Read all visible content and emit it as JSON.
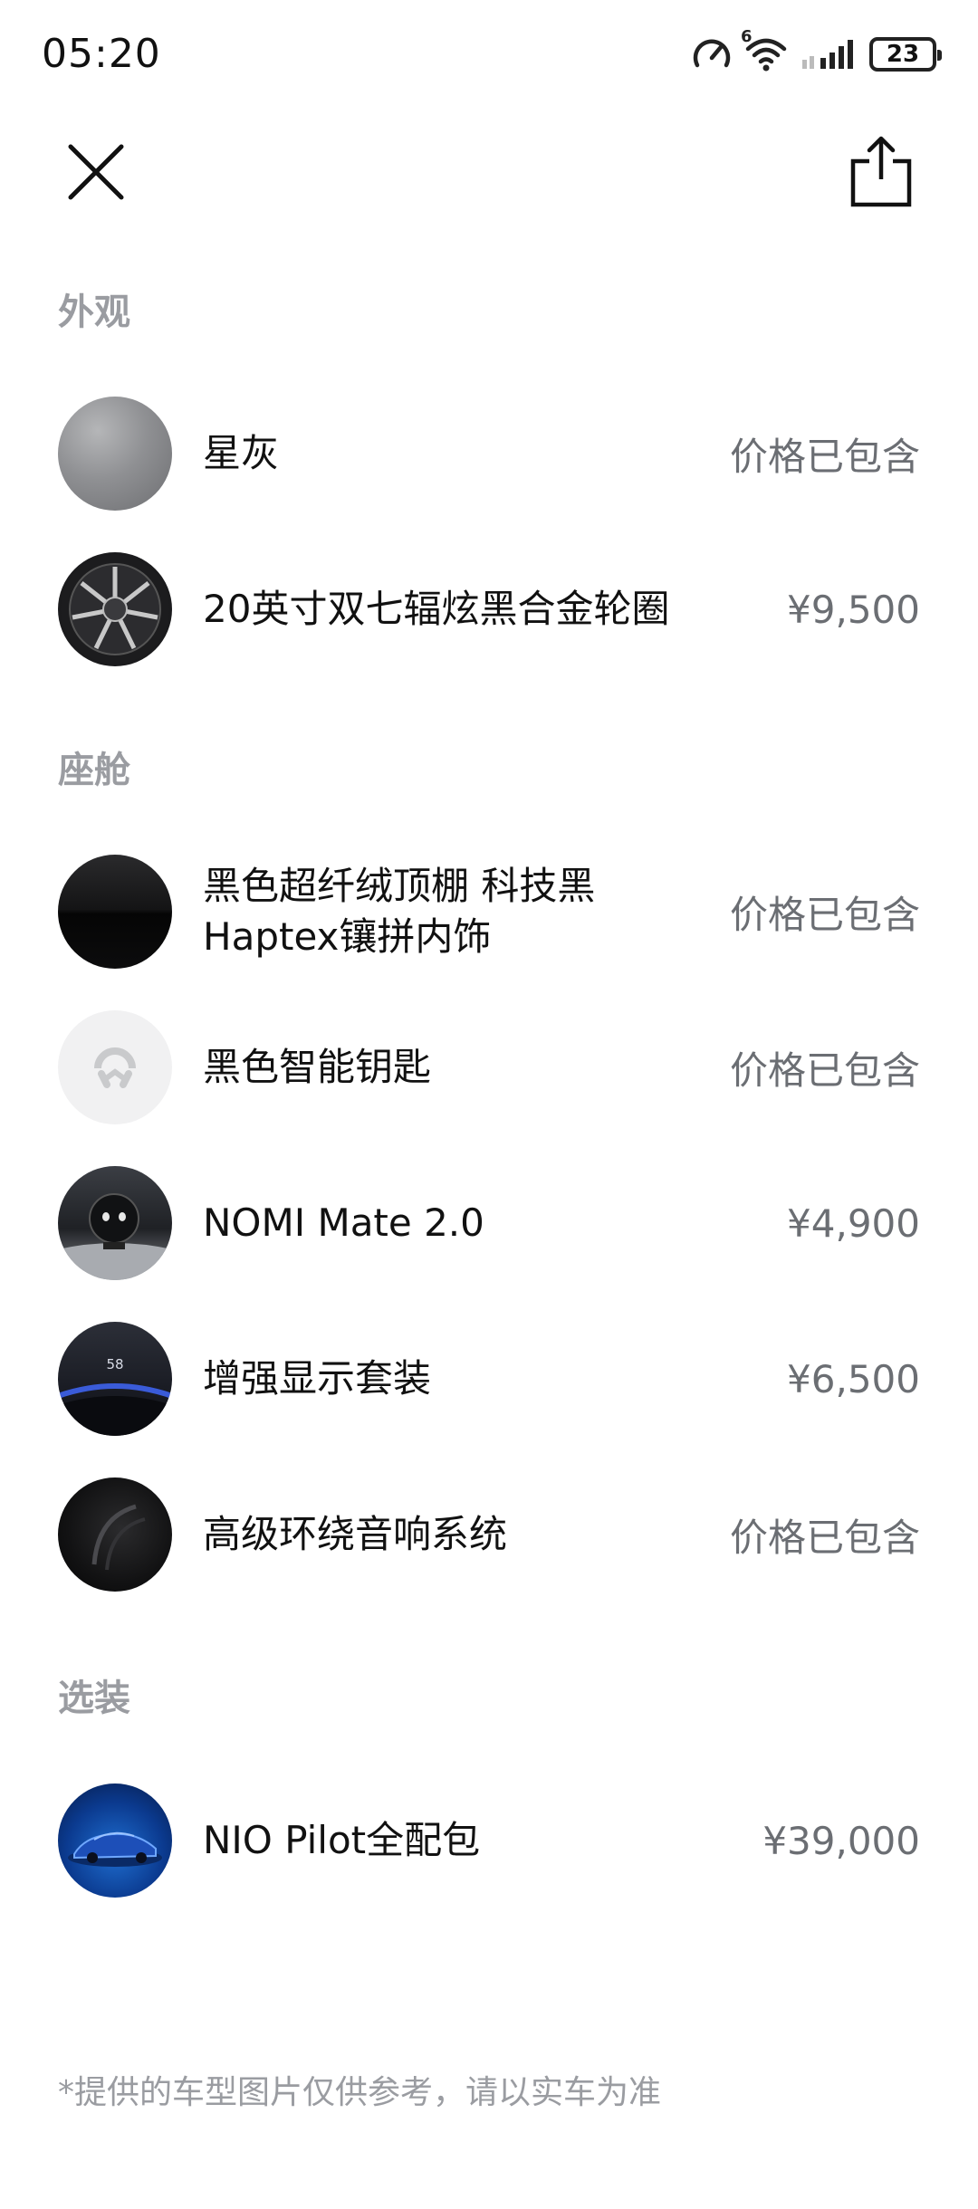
{
  "status_bar": {
    "time": "05:20",
    "network_label": "6",
    "battery_level": "23",
    "icons": [
      "speedometer-icon",
      "wifi-icon",
      "signal-icon",
      "battery-icon"
    ]
  },
  "header": {
    "close_icon": "close-icon",
    "share_icon": "share-icon"
  },
  "sections": [
    {
      "title": "外观",
      "items": [
        {
          "label": "星灰",
          "price": "价格已包含",
          "thumb": "gray-paint-swatch"
        },
        {
          "label": "20英寸双七辐炫黑合金轮圈",
          "price": "¥9,500",
          "thumb": "wheel-rim"
        }
      ]
    },
    {
      "title": "座舱",
      "items": [
        {
          "label_line1": "黑色超纤绒顶棚 科技黑",
          "label_line2": "Haptex镶拼内饰",
          "price": "价格已包含",
          "thumb": "black-interior-fabric"
        },
        {
          "label": "黑色智能钥匙",
          "price": "价格已包含",
          "thumb": "nio-key"
        },
        {
          "label": "NOMI Mate 2.0",
          "price": "¥4,900",
          "thumb": "nomi-robot"
        },
        {
          "label": "增强显示套装",
          "price": "¥6,500",
          "thumb": "head-up-display",
          "thumb_text": "58"
        },
        {
          "label": "高级环绕音响系统",
          "price": "价格已包含",
          "thumb": "speaker-grille"
        }
      ]
    },
    {
      "title": "选装",
      "items": [
        {
          "label": "NIO Pilot全配包",
          "price": "¥39,000",
          "thumb": "blue-car"
        }
      ]
    }
  ],
  "disclaimer": "*提供的车型图片仅供参考，请以实车为准",
  "colors": {
    "section_title": "#9a9ca1",
    "price_text": "#6b6e73",
    "primary_text": "#111111",
    "background": "#ffffff"
  }
}
